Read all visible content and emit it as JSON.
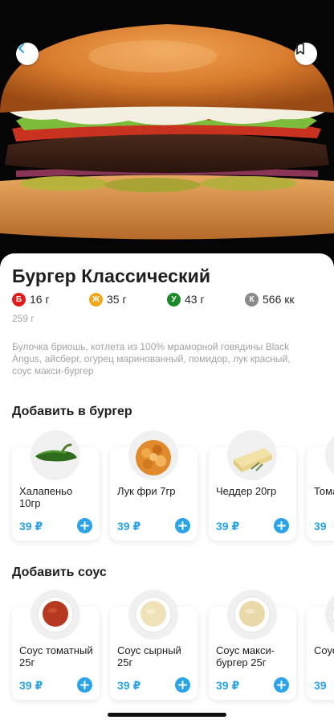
{
  "product": {
    "title": "Бургер Классический",
    "weight": "259 г",
    "description": "Булочка бриошь, котлета из 100% мраморной говядины Black Angus, айсберг, огурец маринованный, помидор, лук красный, соус макси-бургер",
    "nutrition": [
      {
        "letter": "Б",
        "value": "16 г",
        "color": "#e21b1b"
      },
      {
        "letter": "Ж",
        "value": "35 г",
        "color": "#f2a619"
      },
      {
        "letter": "У",
        "value": "43 г",
        "color": "#1d8a2a"
      },
      {
        "letter": "К",
        "value": "566 кк",
        "color": "#8a8a8a"
      }
    ]
  },
  "header": {
    "back_icon": "chevron-left-icon",
    "bookmark_icon": "bookmark-icon"
  },
  "addons": {
    "title": "Добавить в бургер",
    "items": [
      {
        "name": "Халапеньо 10гр",
        "price": "39 ₽",
        "icon": "jalapeno"
      },
      {
        "name": "Лук фри 7гр",
        "price": "39 ₽",
        "icon": "fried-onion"
      },
      {
        "name": "Чеддер 20гр",
        "price": "39 ₽",
        "icon": "cheddar"
      },
      {
        "name": "Тома",
        "price": "39",
        "icon": "tomato"
      }
    ]
  },
  "sauces": {
    "title": "Добавить соус",
    "items": [
      {
        "name": "Соус томатный 25г",
        "price": "39 ₽",
        "icon": "tomato-sauce"
      },
      {
        "name": "Соус сырный 25г",
        "price": "39 ₽",
        "icon": "cheese-sauce"
      },
      {
        "name": "Соус макси-бургер 25г",
        "price": "39 ₽",
        "icon": "burger-sauce"
      },
      {
        "name": "Соус",
        "price": "39",
        "icon": "sauce"
      }
    ]
  },
  "colors": {
    "accent": "#2aa3e8",
    "background": "#ffffff",
    "hero_background": "#050505"
  }
}
